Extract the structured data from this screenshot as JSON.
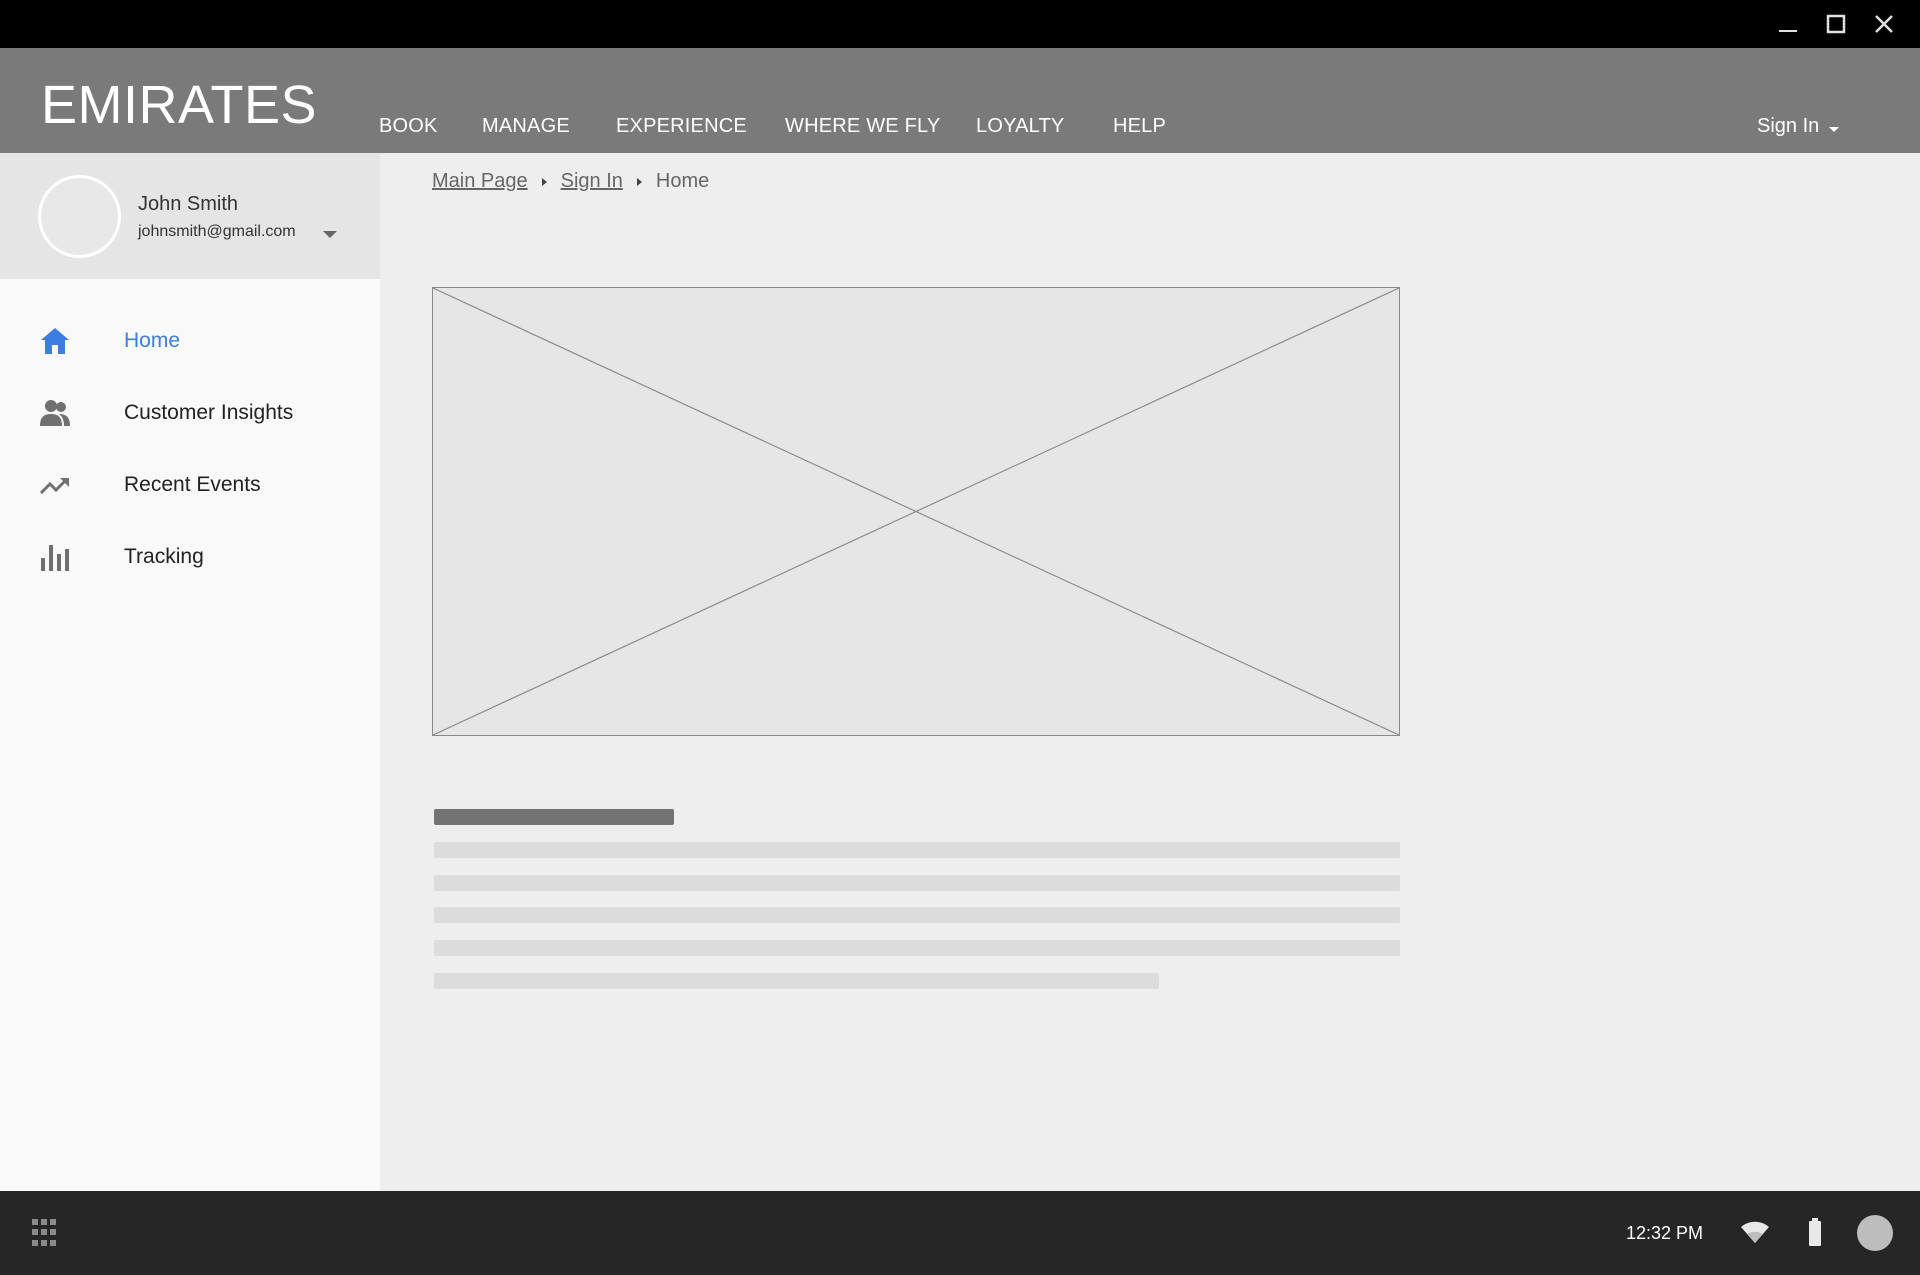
{
  "window": {
    "controls": [
      "minimize-icon",
      "maximize-icon",
      "close-icon"
    ]
  },
  "header": {
    "brand": "EMIRATES",
    "nav": [
      {
        "label": "BOOK"
      },
      {
        "label": "MANAGE"
      },
      {
        "label": "EXPERIENCE"
      },
      {
        "label": "WHERE WE FLY"
      },
      {
        "label": "LOYALTY"
      },
      {
        "label": "HELP"
      }
    ],
    "signin_label": "Sign In"
  },
  "sidebar": {
    "user": {
      "name": "John Smith",
      "email": "johnsmith@gmail.com"
    },
    "items": [
      {
        "label": "Home",
        "icon": "home-icon",
        "active": true
      },
      {
        "label": "Customer Insights",
        "icon": "people-icon",
        "active": false
      },
      {
        "label": "Recent Events",
        "icon": "trending-up-icon",
        "active": false
      },
      {
        "label": "Tracking",
        "icon": "bar-chart-icon",
        "active": false
      }
    ],
    "active_color": "#3b7de0"
  },
  "breadcrumb": {
    "items": [
      {
        "label": "Main Page",
        "link": true
      },
      {
        "label": "Sign In",
        "link": true
      },
      {
        "label": "Home",
        "link": false
      }
    ]
  },
  "taskbar": {
    "time": "12:32 PM",
    "icons": [
      "launcher-icon",
      "wifi-icon",
      "battery-icon",
      "user-avatar"
    ]
  },
  "colors": {
    "titlebar": "#000000",
    "header": "#7a7a7b",
    "sidebar": "#f9f9f9",
    "profile": "#e5e5e5",
    "main": "#eeeeee",
    "taskbar": "#262626"
  }
}
